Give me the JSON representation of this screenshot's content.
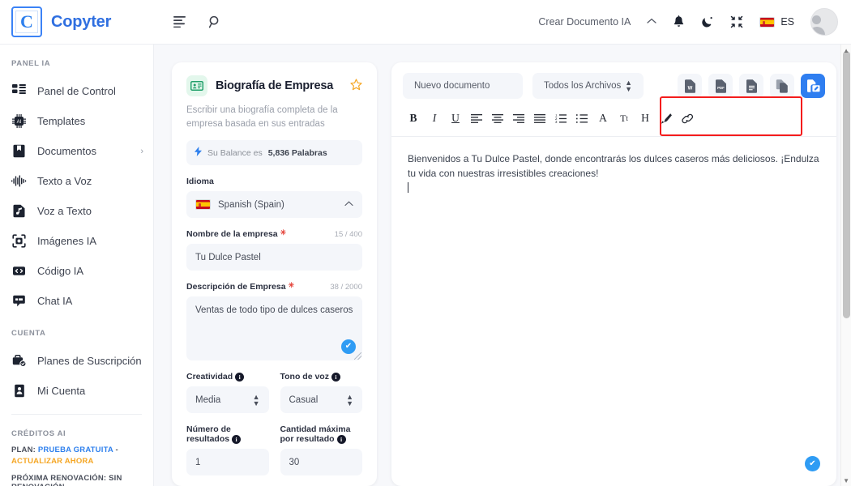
{
  "brand": {
    "logo_letter": "C",
    "name": "Copyter"
  },
  "topbar": {
    "menu_icon": "hamburger-icon",
    "search_icon": "search-icon",
    "create_doc_label": "Crear Documento IA",
    "chevron_icon": "chevron-up-icon",
    "bell_icon": "bell-icon",
    "dark_mode_icon": "moon-icon",
    "fullscreen_icon": "compress-icon",
    "language_code": "ES",
    "avatar_icon": "user-avatar"
  },
  "sidebar": {
    "section_panel": "PANEL IA",
    "items": [
      {
        "label": "Panel de Control",
        "icon": "dashboard-icon",
        "chevron": ""
      },
      {
        "label": "Templates",
        "icon": "chip-ai-icon",
        "chevron": ""
      },
      {
        "label": "Documentos",
        "icon": "documents-icon",
        "chevron": "›"
      },
      {
        "label": "Texto a Voz",
        "icon": "waveform-icon",
        "chevron": ""
      },
      {
        "label": "Voz a Texto",
        "icon": "audio-file-icon",
        "chevron": ""
      },
      {
        "label": "Imágenes IA",
        "icon": "camera-frame-icon",
        "chevron": ""
      },
      {
        "label": "Código IA",
        "icon": "code-icon",
        "chevron": ""
      },
      {
        "label": "Chat IA",
        "icon": "chat-icon",
        "chevron": ""
      }
    ],
    "section_account": "CUENTA",
    "account_items": [
      {
        "label": "Planes de Suscripción",
        "icon": "subscription-icon"
      },
      {
        "label": "Mi Cuenta",
        "icon": "id-card-icon"
      }
    ],
    "section_credits": "CRÉDITOS AI",
    "plan_prefix": "PLAN:",
    "plan_name": "PRUEBA GRATUITA",
    "plan_dash": "-",
    "plan_upgrade": "ACTUALIZAR AHORA",
    "renewal": "PRÓXIMA RENOVACIÓN: SIN RENOVACIÓN"
  },
  "form": {
    "icon": "contact-card-icon",
    "title": "Biografía de Empresa",
    "star_icon": "star-icon",
    "description": "Escribir una biografía completa de la empresa basada en sus entradas",
    "balance_icon": "bolt-icon",
    "balance_prefix": "Su Balance es",
    "balance_value": "5,836 Palabras",
    "language_label": "Idioma",
    "language_value": "Spanish (Spain)",
    "language_caret": "chevron-up-icon",
    "company_name_label": "Nombre de la empresa",
    "company_name_counter": "15 / 400",
    "company_name_value": "Tu Dulce Pastel",
    "company_desc_label": "Descripción de Empresa",
    "company_desc_counter": "38 / 2000",
    "company_desc_value": "Ventas de todo tipo de dulces caseros",
    "creativity_label": "Creatividad",
    "creativity_value": "Media",
    "tone_label": "Tono de voz",
    "tone_value": "Casual",
    "results_label": "Número de resultados",
    "results_value": "1",
    "maxlen_label": "Cantidad máxima por resultado",
    "maxlen_value": "30",
    "check_badge_icon": "check-circle-icon"
  },
  "editor": {
    "doc_selector_value": "Nuevo documento",
    "files_selector_value": "Todos los Archivos",
    "export_buttons": [
      {
        "name": "export-word-button",
        "icon": "word-file-icon",
        "label": "W"
      },
      {
        "name": "export-pdf-button",
        "icon": "pdf-file-icon",
        "label": "PDF"
      },
      {
        "name": "export-text-button",
        "icon": "text-file-icon",
        "label": ""
      },
      {
        "name": "copy-button",
        "icon": "copy-icon",
        "label": ""
      },
      {
        "name": "save-document-button",
        "icon": "save-document-icon",
        "label": ""
      }
    ],
    "toolbar": [
      {
        "name": "bold-button",
        "glyph": "B"
      },
      {
        "name": "italic-button",
        "glyph": "I"
      },
      {
        "name": "underline-button",
        "glyph": "U"
      },
      {
        "name": "align-left-button",
        "glyph": "align-left-icon"
      },
      {
        "name": "align-center-button",
        "glyph": "align-center-icon"
      },
      {
        "name": "align-right-button",
        "glyph": "align-right-icon"
      },
      {
        "name": "align-justify-button",
        "glyph": "align-justify-icon"
      },
      {
        "name": "ordered-list-button",
        "glyph": "ordered-list-icon"
      },
      {
        "name": "unordered-list-button",
        "glyph": "unordered-list-icon"
      },
      {
        "name": "font-color-button",
        "glyph": "A"
      },
      {
        "name": "font-size-button",
        "glyph": "Tt"
      },
      {
        "name": "heading-button",
        "glyph": "H"
      },
      {
        "name": "highlight-button",
        "glyph": "brush-icon"
      },
      {
        "name": "link-button",
        "glyph": "link-icon"
      }
    ],
    "content": "Bienvenidos a Tu Dulce Pastel, donde encontrarás los dulces caseros más deliciosos. ¡Endulza tu vida con nuestras irresistibles creaciones!",
    "check_badge_icon": "check-circle-icon",
    "highlight_color": "#f41c1c"
  },
  "colors": {
    "brand_blue": "#2f6fe0",
    "accent_blue": "#2f7ef0",
    "badge_blue": "#2f9cf4",
    "star_orange": "#f5a623",
    "required_red": "#e4443b",
    "highlight_red": "#f41c1c",
    "canvas_bg": "#f7f8fb",
    "field_bg": "#f4f6fa"
  }
}
